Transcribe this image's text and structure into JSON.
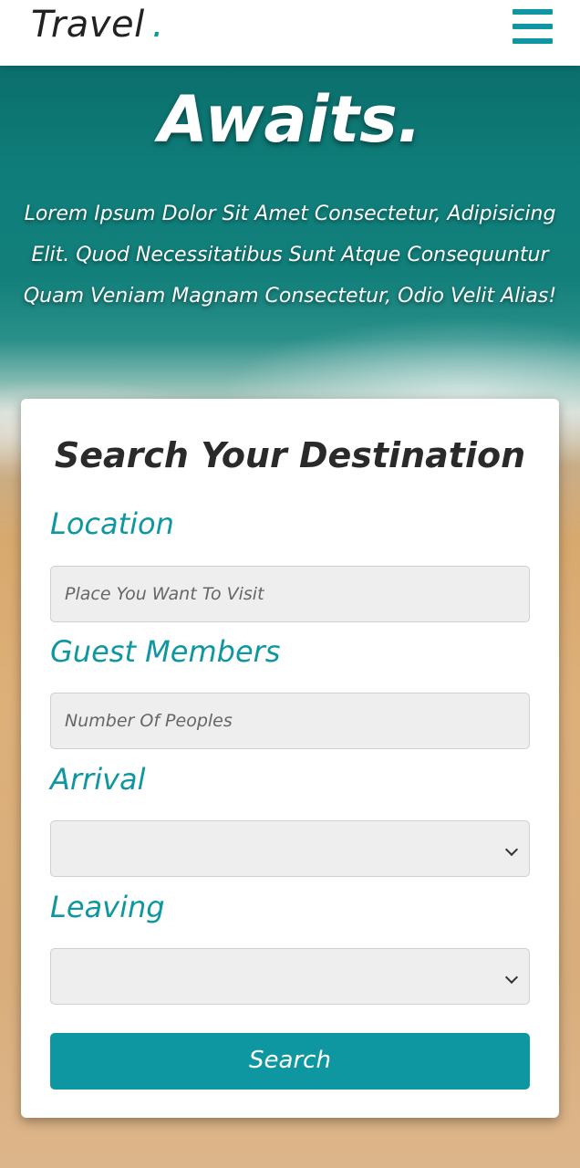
{
  "header": {
    "logo_text": "Travel",
    "logo_dot": ".",
    "menu_icon": "hamburger-menu-icon",
    "accent_color": "#0e97a0"
  },
  "hero": {
    "title": "Awaits.",
    "description": "Lorem Ipsum Dolor Sit Amet Consectetur, Adipisicing Elit. Quod Necessitatibus Sunt Atque Consequuntur Quam Veniam Magnam Consectetur, Odio Velit Alias!"
  },
  "search_form": {
    "title": "Search Your Destination",
    "location": {
      "label": "Location",
      "placeholder": "Place You Want To Visit"
    },
    "guests": {
      "label": "Guest Members",
      "placeholder": "Number Of Peoples"
    },
    "arrival": {
      "label": "Arrival",
      "selected": ""
    },
    "leaving": {
      "label": "Leaving",
      "selected": ""
    },
    "submit_label": "Search"
  }
}
